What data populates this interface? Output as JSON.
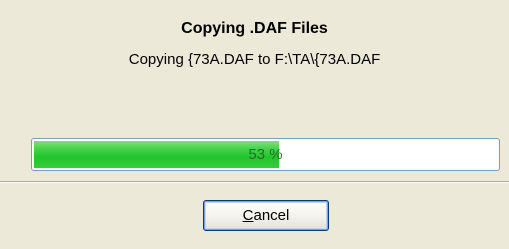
{
  "dialog": {
    "title": "Copying .DAF Files",
    "message": "Copying {73A.DAF to F:\\TA\\{73A.DAF"
  },
  "progress": {
    "value": 53,
    "label": "53 %",
    "fill_color": "#22c42c"
  },
  "buttons": {
    "cancel_mnemonic": "C",
    "cancel_rest": "ancel"
  }
}
